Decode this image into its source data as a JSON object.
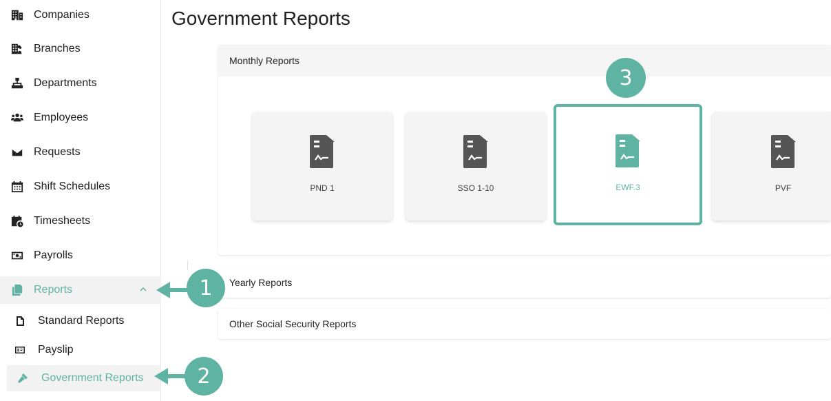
{
  "sidebar": {
    "items": [
      {
        "label": "Companies",
        "icon": "building-icon"
      },
      {
        "label": "Branches",
        "icon": "branches-icon"
      },
      {
        "label": "Departments",
        "icon": "sitemap-icon"
      },
      {
        "label": "Employees",
        "icon": "users-icon"
      },
      {
        "label": "Requests",
        "icon": "envelope-icon"
      },
      {
        "label": "Shift Schedules",
        "icon": "calendar-icon"
      },
      {
        "label": "Timesheets",
        "icon": "calendar-clock-icon"
      },
      {
        "label": "Payrolls",
        "icon": "money-icon"
      },
      {
        "label": "Reports",
        "icon": "copy-icon"
      }
    ],
    "sub_items": [
      {
        "label": "Standard Reports",
        "icon": "file-icon"
      },
      {
        "label": "Payslip",
        "icon": "id-card-icon"
      },
      {
        "label": "Government Reports",
        "icon": "gavel-icon"
      }
    ]
  },
  "main": {
    "title": "Government Reports",
    "sections": {
      "monthly": "Monthly Reports",
      "yearly": "Yearly Reports",
      "other": "Other Social Security Reports"
    },
    "cards": [
      "PND 1",
      "SSO 1-10",
      "EWF.3",
      "PVF"
    ]
  },
  "annotations": [
    "1",
    "2",
    "3"
  ],
  "colors": {
    "accent": "#5fb3a3",
    "card_bg": "#f4f4f4",
    "icon_gray": "#555555"
  }
}
